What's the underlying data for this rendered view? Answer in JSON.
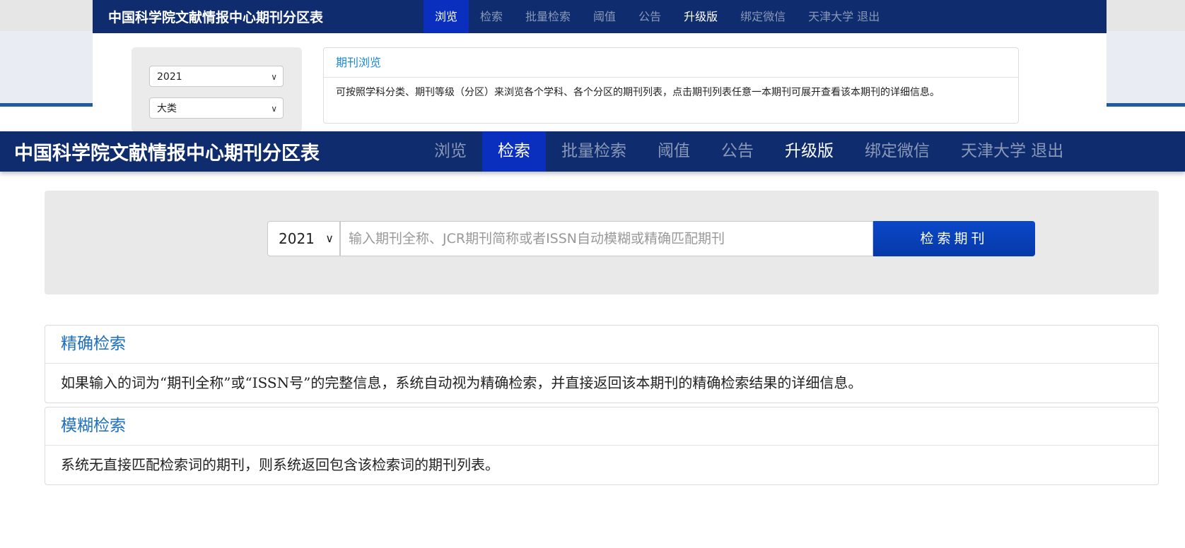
{
  "background_page": {
    "brand": "中国科学院文献情报中心期刊分区表",
    "nav": [
      "浏览",
      "检索",
      "批量检索",
      "阈值",
      "公告",
      "升级版",
      "绑定微信",
      "天津大学 退出"
    ],
    "selects": {
      "year": "2021",
      "category": "大类"
    },
    "panel": {
      "title": "期刊浏览",
      "body": "可按照学科分类、期刊等级（分区）来浏览各个学科、各个分区的期刊列表，点击期刊列表任意一本期刊可展开查看该本期刊的详细信息。"
    }
  },
  "header": {
    "brand": "中国科学院文献情报中心期刊分区表",
    "nav": [
      "浏览",
      "检索",
      "批量检索",
      "阈值",
      "公告",
      "升级版",
      "绑定微信",
      "天津大学 退出"
    ]
  },
  "search": {
    "year": "2021",
    "placeholder": "输入期刊全称、JCR期刊简称或者ISSN自动模糊或精确匹配期刊",
    "button": "检索期刊"
  },
  "panels": [
    {
      "title": "精确检索",
      "body": "如果输入的词为“期刊全称”或“ISSN号”的完整信息，系统自动视为精确检索，并直接返回该本期刊的精确检索结果的详细信息。"
    },
    {
      "title": "模糊检索",
      "body": "系统无直接匹配检索词的期刊，则系统返回包含该检索词的期刊列表。"
    }
  ]
}
